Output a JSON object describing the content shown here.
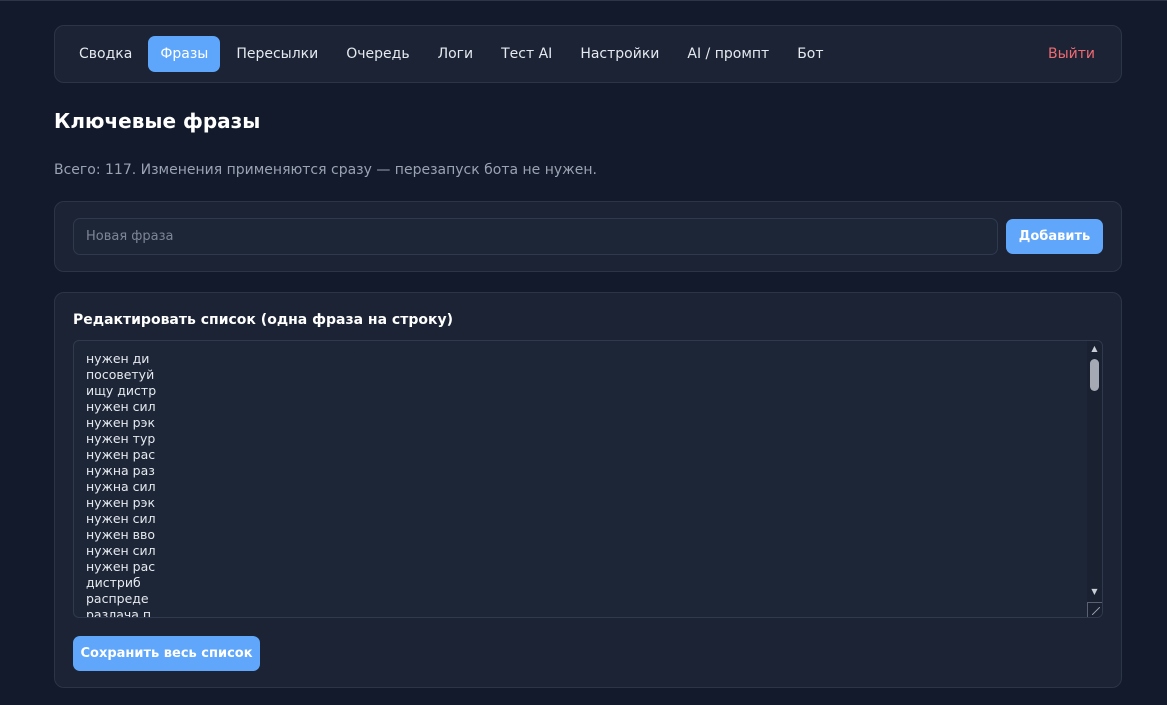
{
  "nav": {
    "items": [
      {
        "label": "Сводка",
        "active": false
      },
      {
        "label": "Фразы",
        "active": true
      },
      {
        "label": "Пересылки",
        "active": false
      },
      {
        "label": "Очередь",
        "active": false
      },
      {
        "label": "Логи",
        "active": false
      },
      {
        "label": "Тест AI",
        "active": false
      },
      {
        "label": "Настройки",
        "active": false
      },
      {
        "label": "AI / промпт",
        "active": false
      },
      {
        "label": "Бот",
        "active": false
      }
    ],
    "logout_label": "Выйти"
  },
  "page": {
    "title": "Ключевые фразы",
    "subtitle": "Всего: 117. Изменения применяются сразу — перезапуск бота не нужен."
  },
  "add_form": {
    "placeholder": "Новая фраза",
    "value": "",
    "add_label": "Добавить"
  },
  "editor": {
    "label": "Редактировать список (одна фраза на строку)",
    "lines": [
      "нужен ди",
      "посоветуй",
      "ищу дистр",
      "нужен сил",
      "нужен рэк",
      "нужен тур",
      "нужен рас",
      "нужна раз",
      "нужна сил",
      "нужен рэк",
      "нужен сил",
      "нужен вво",
      "нужен сил",
      "нужен рас",
      "дистриб",
      "распреде",
      "разлача п"
    ],
    "save_label": "Сохранить весь список"
  },
  "colors": {
    "background": "#121a2b",
    "card": "#1b2334",
    "accent": "#60a6fa",
    "logout": "#f06a72"
  }
}
